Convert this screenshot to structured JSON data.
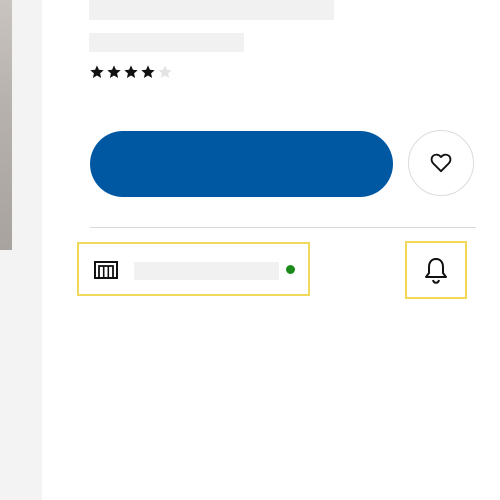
{
  "colors": {
    "primary_button": "#0058a3",
    "focus_outline": "#f0d85a",
    "availability_dot": "#1a8a1a",
    "star_filled": "#111111",
    "star_empty": "#e3e3e3"
  },
  "product": {
    "rating": {
      "value": 4,
      "max": 5
    }
  },
  "icons": {
    "favourite": "heart-icon",
    "store": "store-icon",
    "notify": "bell-icon"
  }
}
